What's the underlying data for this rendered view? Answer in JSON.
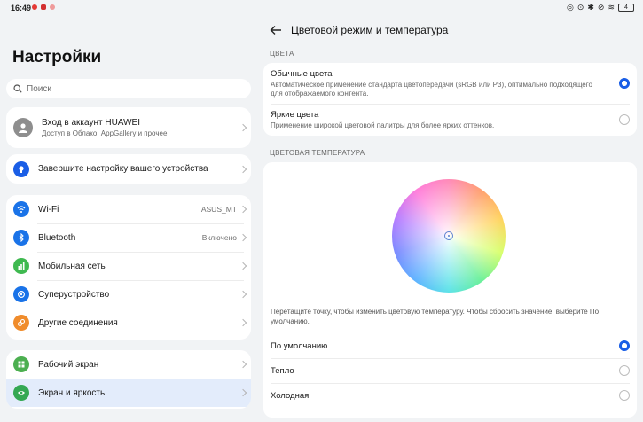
{
  "status": {
    "time": "16:49",
    "battery": "4"
  },
  "left": {
    "title": "Настройки",
    "search_placeholder": "Поиск",
    "account": {
      "title": "Вход в аккаунт HUAWEI",
      "subtitle": "Доступ в Облако, AppGallery и прочее"
    },
    "setup": {
      "label": "Завершите настройку вашего устройства"
    },
    "network": [
      {
        "label": "Wi-Fi",
        "value": "ASUS_MT",
        "color": "#1a73e8"
      },
      {
        "label": "Bluetooth",
        "value": "Включено",
        "color": "#1a73e8"
      },
      {
        "label": "Мобильная сеть",
        "value": "",
        "color": "#3fb950"
      },
      {
        "label": "Суперустройство",
        "value": "",
        "color": "#1a73e8"
      },
      {
        "label": "Другие соединения",
        "value": "",
        "color": "#f08c2b"
      }
    ],
    "display": [
      {
        "label": "Рабочий экран",
        "color": "#4caf50"
      },
      {
        "label": "Экран и яркость",
        "color": "#34a853"
      }
    ]
  },
  "right": {
    "header": "Цветовой режим и температура",
    "colors_section": "ЦВЕТА",
    "colors": [
      {
        "title": "Обычные цвета",
        "desc": "Автоматическое применение стандарта цветопередачи (sRGB или P3), оптимально подходящего для отображаемого контента.",
        "selected": true
      },
      {
        "title": "Яркие цвета",
        "desc": "Применение широкой цветовой палитры для более ярких оттенков.",
        "selected": false
      }
    ],
    "temp_section": "ЦВЕТОВАЯ ТЕМПЕРАТУРА",
    "hint": "Перетащите точку, чтобы изменить цветовую температуру. Чтобы сбросить значение, выберите По умолчанию.",
    "temps": [
      {
        "label": "По умолчанию",
        "selected": true
      },
      {
        "label": "Тепло",
        "selected": false
      },
      {
        "label": "Холодная",
        "selected": false
      }
    ]
  },
  "accent": "#1a5ee6"
}
